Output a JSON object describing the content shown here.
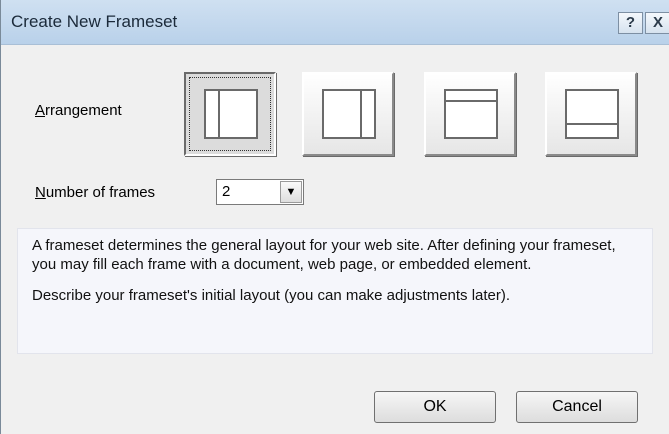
{
  "window": {
    "title": "Create New Frameset",
    "help_button": "?",
    "close_button": "X"
  },
  "arrangement": {
    "label_mnemonic": "A",
    "label_rest": "rrangement",
    "options": [
      {
        "icon": "two-columns-left-narrow-icon",
        "selected": true
      },
      {
        "icon": "two-columns-right-narrow-icon",
        "selected": false
      },
      {
        "icon": "two-rows-top-narrow-icon",
        "selected": false
      },
      {
        "icon": "two-rows-bottom-narrow-icon",
        "selected": false
      }
    ]
  },
  "frames": {
    "label_mnemonic": "N",
    "label_rest": "umber of frames",
    "value": "2",
    "dropdown_icon": "chevron-down-icon"
  },
  "description": {
    "paragraph1": "A frameset determines the general layout for your web site.  After defining your frameset, you may fill each frame with a document, web page, or embedded element.",
    "paragraph2": "Describe your frameset's initial layout (you can make adjustments later)."
  },
  "buttons": {
    "ok": "OK",
    "cancel": "Cancel"
  }
}
